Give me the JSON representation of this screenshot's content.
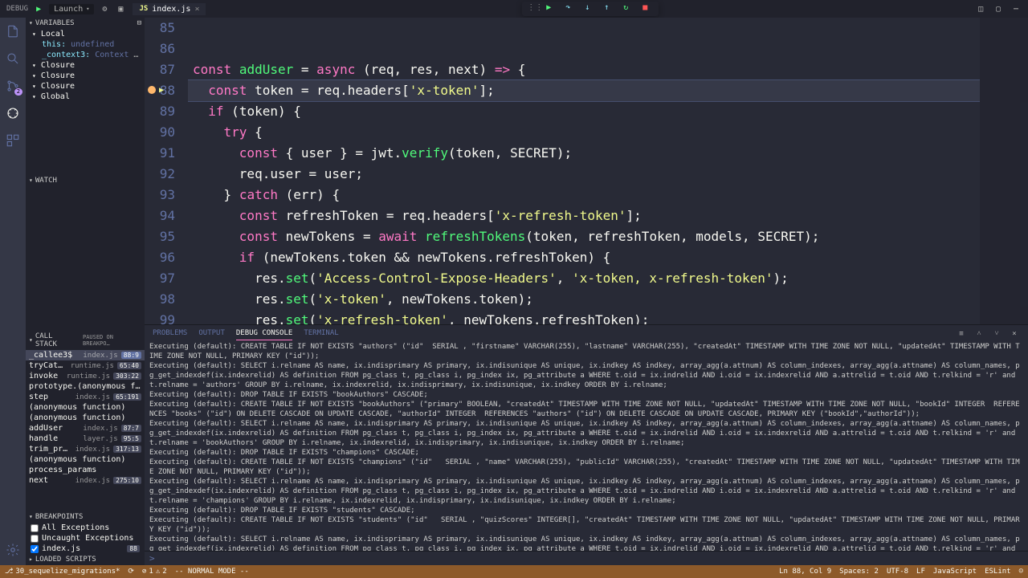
{
  "titlebar": {
    "debug_label": "DEBUG",
    "launch_label": "Launch",
    "tab_filename": "index.js"
  },
  "activity": {
    "scm_badge": "2"
  },
  "variables": {
    "header": "VARIABLES",
    "scopes": [
      {
        "name": "Local",
        "items": [
          {
            "key": "this:",
            "val": "undefined"
          },
          {
            "key": "_context3:",
            "val": "Context {tryEntri…"
          }
        ]
      },
      {
        "name": "Closure"
      },
      {
        "name": "Closure"
      },
      {
        "name": "Closure"
      },
      {
        "name": "Global"
      }
    ]
  },
  "watch": {
    "header": "WATCH"
  },
  "callstack": {
    "header": "CALL STACK",
    "status": "PAUSED ON BREAKPO…",
    "frames": [
      {
        "fn": "_callee3$",
        "file": "index.js",
        "loc": "88:9",
        "sel": true
      },
      {
        "fn": "tryCatch",
        "file": "runtime.js",
        "loc": "65:40"
      },
      {
        "fn": "invoke",
        "file": "runtime.js",
        "loc": "303:22"
      },
      {
        "fn": "prototype.(anonymous functi…",
        "file": "",
        "loc": ""
      },
      {
        "fn": "step",
        "file": "index.js",
        "loc": "65:191"
      },
      {
        "fn": "(anonymous function)",
        "file": "",
        "loc": ""
      },
      {
        "fn": "(anonymous function)",
        "file": "",
        "loc": ""
      },
      {
        "fn": "addUser",
        "file": "index.js",
        "loc": "87:7"
      },
      {
        "fn": "handle",
        "file": "layer.js",
        "loc": "95:5"
      },
      {
        "fn": "trim_prefix",
        "file": "index.js",
        "loc": "317:13"
      },
      {
        "fn": "(anonymous function)",
        "file": "",
        "loc": ""
      },
      {
        "fn": "process_params",
        "file": "",
        "loc": ""
      },
      {
        "fn": "next",
        "file": "index.js",
        "loc": "275:10"
      }
    ]
  },
  "breakpoints": {
    "header": "BREAKPOINTS",
    "items": [
      {
        "label": "All Exceptions",
        "checked": false
      },
      {
        "label": "Uncaught Exceptions",
        "checked": false
      },
      {
        "label": "index.js",
        "checked": true,
        "loc": "88"
      }
    ]
  },
  "loaded_scripts": {
    "header": "LOADED SCRIPTS"
  },
  "editor": {
    "lines": [
      {
        "n": 85,
        "html": ""
      },
      {
        "n": 86,
        "html": ""
      },
      {
        "n": 87,
        "html": "<span class='tok-kw'>const</span> <span class='tok-fn'>addUser</span> <span class='tok-punc'>=</span> <span class='tok-kw'>async</span> <span class='tok-punc'>(</span><span class='tok-var'>req</span><span class='tok-punc'>,</span> <span class='tok-var'>res</span><span class='tok-punc'>,</span> <span class='tok-var'>next</span><span class='tok-punc'>)</span> <span class='tok-kw'>=&gt;</span> <span class='tok-punc'>{</span>"
      },
      {
        "n": 88,
        "hl": true,
        "bp": true,
        "html": "  <span class='tok-kw'>const</span> <span class='tok-var'>token</span> <span class='tok-punc'>=</span> <span class='tok-var'>req</span><span class='tok-punc'>.</span><span class='tok-prop'>headers</span><span class='tok-punc'>[</span><span class='tok-str'>'x-token'</span><span class='tok-punc'>];</span>"
      },
      {
        "n": 89,
        "html": "  <span class='tok-kw'>if</span> <span class='tok-punc'>(</span><span class='tok-var'>token</span><span class='tok-punc'>)</span> <span class='tok-punc'>{</span>"
      },
      {
        "n": 90,
        "html": "    <span class='tok-kw'>try</span> <span class='tok-punc'>{</span>"
      },
      {
        "n": 91,
        "html": "      <span class='tok-kw'>const</span> <span class='tok-punc'>{</span> <span class='tok-var'>user</span> <span class='tok-punc'>}</span> <span class='tok-punc'>=</span> <span class='tok-var'>jwt</span><span class='tok-punc'>.</span><span class='tok-fn'>verify</span><span class='tok-punc'>(</span><span class='tok-var'>token</span><span class='tok-punc'>,</span> <span class='tok-var'>SECRET</span><span class='tok-punc'>);</span>"
      },
      {
        "n": 92,
        "html": "      <span class='tok-var'>req</span><span class='tok-punc'>.</span><span class='tok-prop'>user</span> <span class='tok-punc'>=</span> <span class='tok-var'>user</span><span class='tok-punc'>;</span>"
      },
      {
        "n": 93,
        "html": "    <span class='tok-punc'>}</span> <span class='tok-kw'>catch</span> <span class='tok-punc'>(</span><span class='tok-var'>err</span><span class='tok-punc'>)</span> <span class='tok-punc'>{</span>"
      },
      {
        "n": 94,
        "html": "      <span class='tok-kw'>const</span> <span class='tok-var'>refreshToken</span> <span class='tok-punc'>=</span> <span class='tok-var'>req</span><span class='tok-punc'>.</span><span class='tok-prop'>headers</span><span class='tok-punc'>[</span><span class='tok-str'>'x-refresh-token'</span><span class='tok-punc'>];</span>"
      },
      {
        "n": 95,
        "html": "      <span class='tok-kw'>const</span> <span class='tok-var'>newTokens</span> <span class='tok-punc'>=</span> <span class='tok-kw'>await</span> <span class='tok-fn'>refreshTokens</span><span class='tok-punc'>(</span><span class='tok-var'>token</span><span class='tok-punc'>,</span> <span class='tok-var'>refreshToken</span><span class='tok-punc'>,</span> <span class='tok-var'>models</span><span class='tok-punc'>,</span> <span class='tok-var'>SECRET</span><span class='tok-punc'>);</span>"
      },
      {
        "n": 96,
        "html": "      <span class='tok-kw'>if</span> <span class='tok-punc'>(</span><span class='tok-var'>newTokens</span><span class='tok-punc'>.</span><span class='tok-prop'>token</span> <span class='tok-punc'>&amp;&amp;</span> <span class='tok-var'>newTokens</span><span class='tok-punc'>.</span><span class='tok-prop'>refreshToken</span><span class='tok-punc'>)</span> <span class='tok-punc'>{</span>"
      },
      {
        "n": 97,
        "html": "        <span class='tok-var'>res</span><span class='tok-punc'>.</span><span class='tok-fn'>set</span><span class='tok-punc'>(</span><span class='tok-str'>'Access-Control-Expose-Headers'</span><span class='tok-punc'>,</span> <span class='tok-str'>'x-token, x-refresh-token'</span><span class='tok-punc'>);</span>"
      },
      {
        "n": 98,
        "html": "        <span class='tok-var'>res</span><span class='tok-punc'>.</span><span class='tok-fn'>set</span><span class='tok-punc'>(</span><span class='tok-str'>'x-token'</span><span class='tok-punc'>,</span> <span class='tok-var'>newTokens</span><span class='tok-punc'>.</span><span class='tok-prop'>token</span><span class='tok-punc'>);</span>"
      },
      {
        "n": 99,
        "html": "        <span class='tok-var'>res</span><span class='tok-punc'>.</span><span class='tok-fn'>set</span><span class='tok-punc'>(</span><span class='tok-str'>'x-refresh-token'</span><span class='tok-punc'>,</span> <span class='tok-var'>newTokens</span><span class='tok-punc'>.</span><span class='tok-prop'>refreshToken</span><span class='tok-punc'>);</span>"
      }
    ]
  },
  "panel": {
    "tabs": [
      "PROBLEMS",
      "OUTPUT",
      "DEBUG CONSOLE",
      "TERMINAL"
    ],
    "active": 2,
    "console_lines": [
      "Executing (default): CREATE TABLE IF NOT EXISTS \"authors\" (\"id\"  SERIAL , \"firstname\" VARCHAR(255), \"lastname\" VARCHAR(255), \"createdAt\" TIMESTAMP WITH TIME ZONE NOT NULL, \"updatedAt\" TIMESTAMP WITH TIME ZONE NOT NULL, PRIMARY KEY (\"id\"));",
      "Executing (default): SELECT i.relname AS name, ix.indisprimary AS primary, ix.indisunique AS unique, ix.indkey AS indkey, array_agg(a.attnum) AS column_indexes, array_agg(a.attname) AS column_names, pg_get_indexdef(ix.indexrelid) AS definition FROM pg_class t, pg_class i, pg_index ix, pg_attribute a WHERE t.oid = ix.indrelid AND i.oid = ix.indexrelid AND a.attrelid = t.oid AND t.relkind = 'r' and t.relname = 'authors' GROUP BY i.relname, ix.indexrelid, ix.indisprimary, ix.indisunique, ix.indkey ORDER BY i.relname;",
      "Executing (default): DROP TABLE IF EXISTS \"bookAuthors\" CASCADE;",
      "Executing (default): CREATE TABLE IF NOT EXISTS \"bookAuthors\" (\"primary\" BOOLEAN, \"createdAt\" TIMESTAMP WITH TIME ZONE NOT NULL, \"updatedAt\" TIMESTAMP WITH TIME ZONE NOT NULL, \"bookId\" INTEGER  REFERENCES \"books\" (\"id\") ON DELETE CASCADE ON UPDATE CASCADE, \"authorId\" INTEGER  REFERENCES \"authors\" (\"id\") ON DELETE CASCADE ON UPDATE CASCADE, PRIMARY KEY (\"bookId\",\"authorId\"));",
      "Executing (default): SELECT i.relname AS name, ix.indisprimary AS primary, ix.indisunique AS unique, ix.indkey AS indkey, array_agg(a.attnum) AS column_indexes, array_agg(a.attname) AS column_names, pg_get_indexdef(ix.indexrelid) AS definition FROM pg_class t, pg_class i, pg_index ix, pg_attribute a WHERE t.oid = ix.indrelid AND i.oid = ix.indexrelid AND a.attrelid = t.oid AND t.relkind = 'r' and t.relname = 'bookAuthors' GROUP BY i.relname, ix.indexrelid, ix.indisprimary, ix.indisunique, ix.indkey ORDER BY i.relname;",
      "Executing (default): DROP TABLE IF EXISTS \"champions\" CASCADE;",
      "Executing (default): CREATE TABLE IF NOT EXISTS \"champions\" (\"id\"   SERIAL , \"name\" VARCHAR(255), \"publicId\" VARCHAR(255), \"createdAt\" TIMESTAMP WITH TIME ZONE NOT NULL, \"updatedAt\" TIMESTAMP WITH TIME ZONE NOT NULL, PRIMARY KEY (\"id\"));",
      "Executing (default): SELECT i.relname AS name, ix.indisprimary AS primary, ix.indisunique AS unique, ix.indkey AS indkey, array_agg(a.attnum) AS column_indexes, array_agg(a.attname) AS column_names, pg_get_indexdef(ix.indexrelid) AS definition FROM pg_class t, pg_class i, pg_index ix, pg_attribute a WHERE t.oid = ix.indrelid AND i.oid = ix.indexrelid AND a.attrelid = t.oid AND t.relkind = 'r' and t.relname = 'champions' GROUP BY i.relname, ix.indexrelid, ix.indisprimary, ix.indisunique, ix.indkey ORDER BY i.relname;",
      "Executing (default): DROP TABLE IF EXISTS \"students\" CASCADE;",
      "Executing (default): CREATE TABLE IF NOT EXISTS \"students\" (\"id\"   SERIAL , \"quizScores\" INTEGER[], \"createdAt\" TIMESTAMP WITH TIME ZONE NOT NULL, \"updatedAt\" TIMESTAMP WITH TIME ZONE NOT NULL, PRIMARY KEY (\"id\"));",
      "Executing (default): SELECT i.relname AS name, ix.indisprimary AS primary, ix.indisunique AS unique, ix.indkey AS indkey, array_agg(a.attnum) AS column_indexes, array_agg(a.attname) AS column_names, pg_get_indexdef(ix.indexrelid) AS definition FROM pg_class t, pg_class i, pg_index ix, pg_attribute a WHERE t.oid = ix.indrelid AND i.oid = ix.indexrelid AND a.attrelid = t.oid AND t.relkind = 'r' and t.relname = 'students' GROUP BY i.relname, ix.indexrelid, ix.indisprimary, ix.indisunique, ix.indkey ORDER BY i.relname;"
    ],
    "prompt": ">"
  },
  "statusbar": {
    "branch": "30_sequelize_migrations*",
    "errors": "1",
    "warnings": "2",
    "mode": "-- NORMAL MODE --",
    "ln": "Ln 88, Col 9",
    "spaces": "Spaces: 2",
    "encoding": "UTF-8",
    "eol": "LF",
    "lang": "JavaScript",
    "linter": "ESLint"
  }
}
